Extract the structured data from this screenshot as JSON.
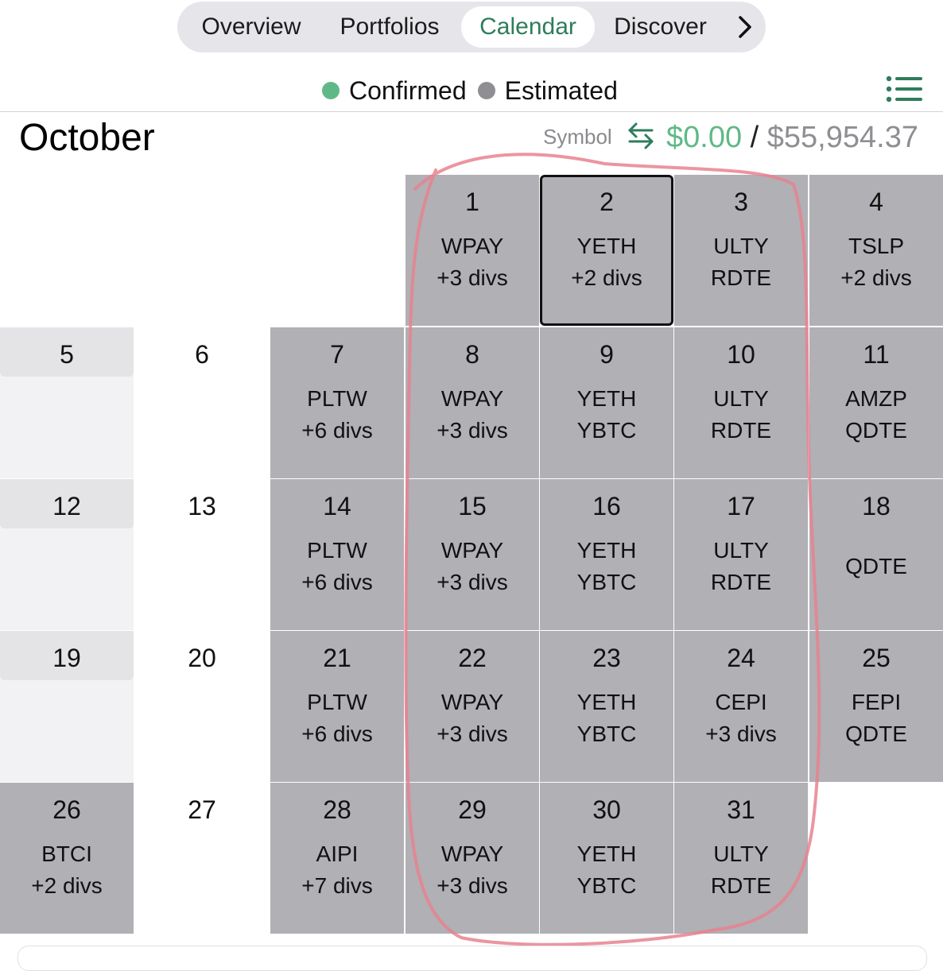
{
  "nav": {
    "tabs": [
      {
        "label": "Overview",
        "active": false
      },
      {
        "label": "Portfolios",
        "active": false
      },
      {
        "label": "Calendar",
        "active": true
      },
      {
        "label": "Discover",
        "active": false
      }
    ],
    "more_icon": "chevron-right-icon"
  },
  "legend": {
    "confirmed": {
      "label": "Confirmed",
      "color": "#5fb987"
    },
    "estimated": {
      "label": "Estimated",
      "color": "#8e8e93"
    },
    "menu_icon": "list-icon"
  },
  "header": {
    "month": "October",
    "sort_label": "Symbol",
    "swap_icon": "swap-arrows-icon",
    "paid": "$0.00",
    "separator": "/",
    "total": "$55,954.37"
  },
  "calendar": {
    "days": [
      {
        "day": "1",
        "line1": "WPAY",
        "line2": "+3 divs"
      },
      {
        "day": "2",
        "line1": "YETH",
        "line2": "+2 divs"
      },
      {
        "day": "3",
        "line1": "ULTY",
        "line2": "RDTE"
      },
      {
        "day": "4",
        "line1": "TSLP",
        "line2": "+2 divs"
      },
      {
        "day": "5",
        "line1": "",
        "line2": ""
      },
      {
        "day": "6",
        "line1": "",
        "line2": ""
      },
      {
        "day": "7",
        "line1": "PLTW",
        "line2": "+6 divs"
      },
      {
        "day": "8",
        "line1": "WPAY",
        "line2": "+3 divs"
      },
      {
        "day": "9",
        "line1": "YETH",
        "line2": "YBTC"
      },
      {
        "day": "10",
        "line1": "ULTY",
        "line2": "RDTE"
      },
      {
        "day": "11",
        "line1": "AMZP",
        "line2": "QDTE"
      },
      {
        "day": "12",
        "line1": "",
        "line2": ""
      },
      {
        "day": "13",
        "line1": "",
        "line2": ""
      },
      {
        "day": "14",
        "line1": "PLTW",
        "line2": "+6 divs"
      },
      {
        "day": "15",
        "line1": "WPAY",
        "line2": "+3 divs"
      },
      {
        "day": "16",
        "line1": "YETH",
        "line2": "YBTC"
      },
      {
        "day": "17",
        "line1": "ULTY",
        "line2": "RDTE"
      },
      {
        "day": "18",
        "line1": "QDTE",
        "line2": ""
      },
      {
        "day": "19",
        "line1": "",
        "line2": ""
      },
      {
        "day": "20",
        "line1": "",
        "line2": ""
      },
      {
        "day": "21",
        "line1": "PLTW",
        "line2": "+6 divs"
      },
      {
        "day": "22",
        "line1": "WPAY",
        "line2": "+3 divs"
      },
      {
        "day": "23",
        "line1": "YETH",
        "line2": "YBTC"
      },
      {
        "day": "24",
        "line1": "CEPI",
        "line2": "+3 divs"
      },
      {
        "day": "25",
        "line1": "FEPI",
        "line2": "QDTE"
      },
      {
        "day": "26",
        "line1": "BTCI",
        "line2": "+2 divs"
      },
      {
        "day": "27",
        "line1": "",
        "line2": ""
      },
      {
        "day": "28",
        "line1": "AIPI",
        "line2": "+7 divs"
      },
      {
        "day": "29",
        "line1": "WPAY",
        "line2": "+3 divs"
      },
      {
        "day": "30",
        "line1": "YETH",
        "line2": "YBTC"
      },
      {
        "day": "31",
        "line1": "ULTY",
        "line2": "RDTE"
      }
    ],
    "selected_day": "2"
  }
}
